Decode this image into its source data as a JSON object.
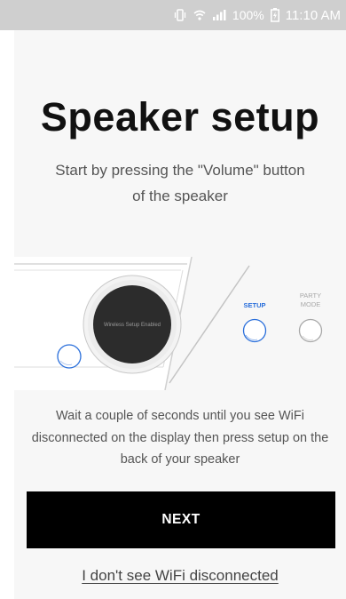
{
  "status_bar": {
    "battery_text": "100%",
    "time": "11:10 AM",
    "icons": [
      "vibrate-icon",
      "wifi-icon",
      "signal-icon",
      "battery-icon"
    ]
  },
  "page": {
    "title": "Speaker setup",
    "subtitle": "Start by pressing the \"Volume\" button of the speaker",
    "instruction": "Wait a couple of seconds until you see WiFi disconnected on the display then press setup on the back of your speaker"
  },
  "illustration": {
    "knob_text": "Wireless Setup Enabled",
    "setup_label": "SETUP",
    "party_mode_label_line1": "PARTY",
    "party_mode_label_line2": "MODE",
    "accent_color": "#2a6fdb"
  },
  "actions": {
    "next_label": "NEXT",
    "help_link_label": "I don't see WiFi disconnected"
  }
}
